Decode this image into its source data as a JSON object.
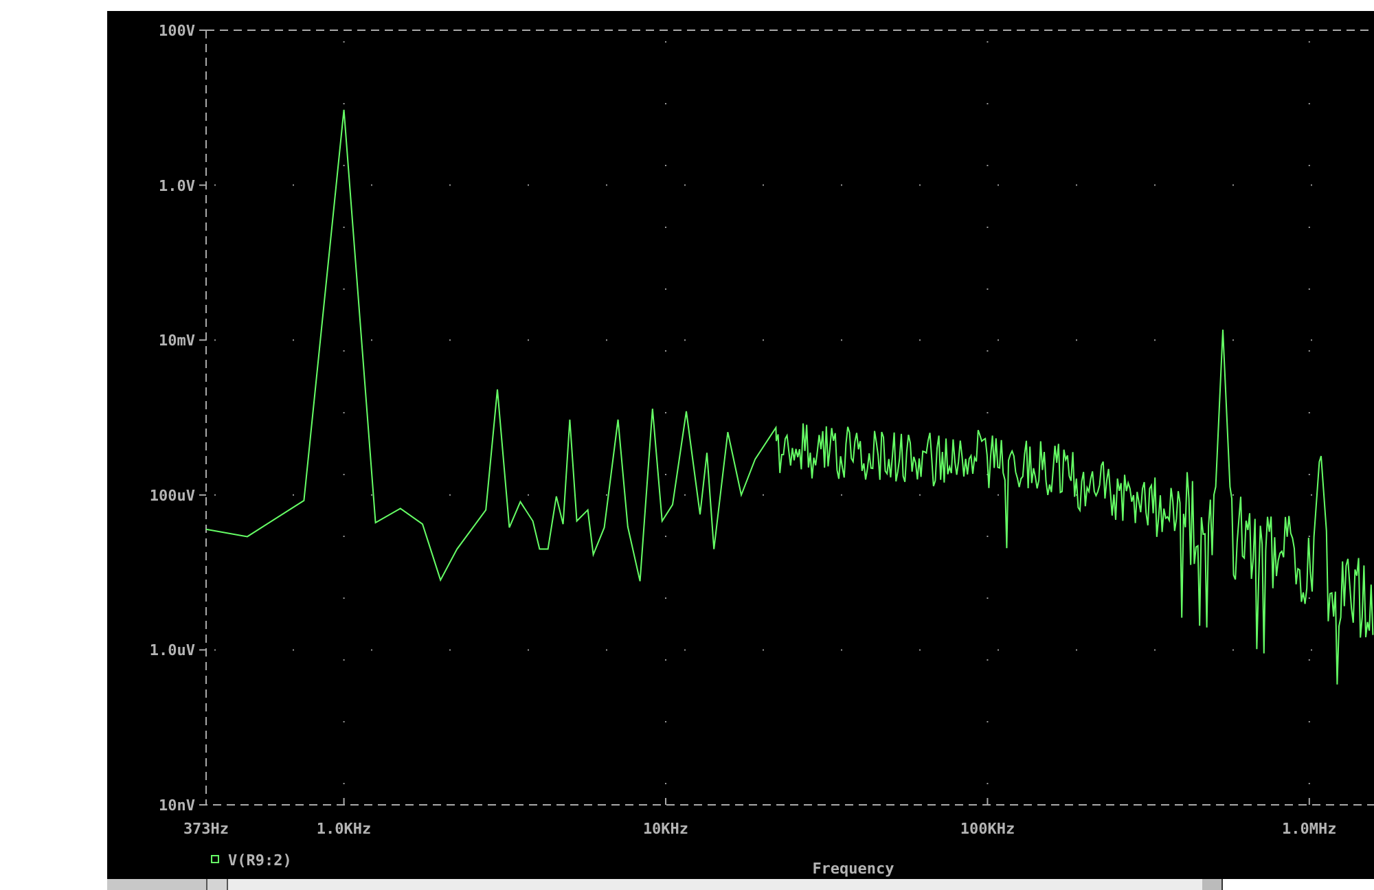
{
  "plot": {
    "y_axis_labels": [
      "100V",
      "1.0V",
      "10mV",
      "100uV",
      "1.0uV",
      "10nV"
    ],
    "x_axis_labels": [
      "373Hz",
      "1.0KHz",
      "10KHz",
      "100KHz",
      "1.0MHz"
    ],
    "legend": [
      {
        "label": "V(R9:2)",
        "color": "#66ff66"
      }
    ],
    "x_axis_title": "Frequency"
  }
}
